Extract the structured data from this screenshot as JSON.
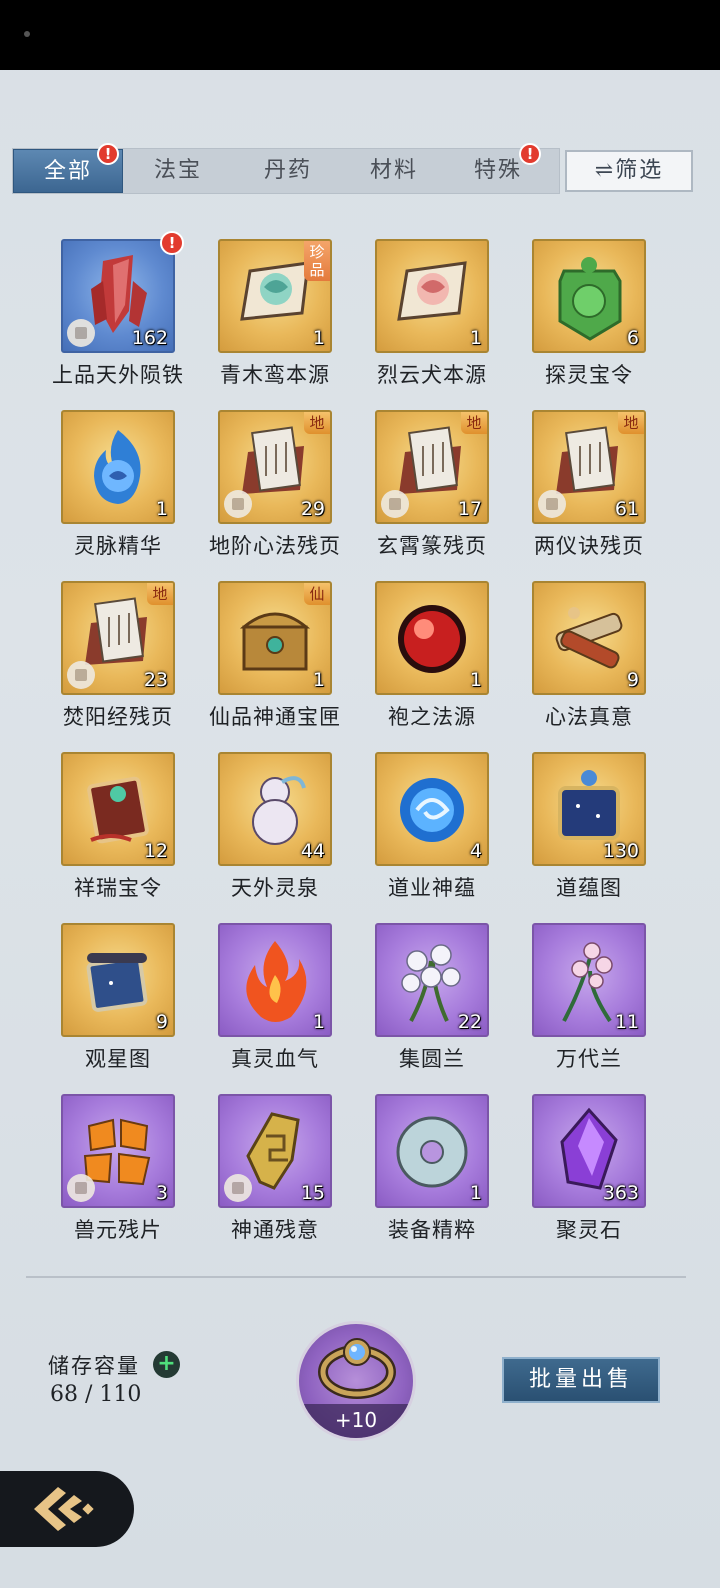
{
  "tabs": [
    {
      "label": "全部",
      "active": true,
      "badge": "!"
    },
    {
      "label": "法宝",
      "active": false
    },
    {
      "label": "丹药",
      "active": false
    },
    {
      "label": "材料",
      "active": false
    },
    {
      "label": "特殊",
      "active": false,
      "badge": "!"
    }
  ],
  "filter_label": "⇌筛选",
  "items": [
    {
      "name": "上品天外陨铁",
      "count": "162",
      "rarity": "blue",
      "icon": "red-crystal-icon",
      "badge": "!"
    },
    {
      "name": "青木鸾本源",
      "count": "1",
      "rarity": "gold",
      "icon": "jade-beast-card-icon",
      "tag": "珍品"
    },
    {
      "name": "烈云犬本源",
      "count": "1",
      "rarity": "gold",
      "icon": "beast-card-icon"
    },
    {
      "name": "探灵宝令",
      "count": "6",
      "rarity": "gold",
      "icon": "green-token-icon"
    },
    {
      "name": "灵脉精华",
      "count": "1",
      "rarity": "gold",
      "icon": "blue-flame-orb-icon"
    },
    {
      "name": "地阶心法残页",
      "count": "29",
      "rarity": "gold",
      "icon": "scripture-page-icon",
      "tag": "地"
    },
    {
      "name": "玄霄篆残页",
      "count": "17",
      "rarity": "gold",
      "icon": "scripture-page-icon",
      "tag": "地"
    },
    {
      "name": "两仪诀残页",
      "count": "61",
      "rarity": "gold",
      "icon": "scripture-page-icon",
      "tag": "地"
    },
    {
      "name": "焚阳经残页",
      "count": "23",
      "rarity": "gold",
      "icon": "scripture-page-icon",
      "tag": "地"
    },
    {
      "name": "仙品神通宝匣",
      "count": "1",
      "rarity": "gold",
      "icon": "treasure-chest-icon",
      "tag": "仙"
    },
    {
      "name": "袍之法源",
      "count": "1",
      "rarity": "gold",
      "icon": "red-orb-icon"
    },
    {
      "name": "心法真意",
      "count": "9",
      "rarity": "gold",
      "icon": "scroll-bundle-icon"
    },
    {
      "name": "祥瑞宝令",
      "count": "12",
      "rarity": "gold",
      "icon": "ornate-token-icon"
    },
    {
      "name": "天外灵泉",
      "count": "44",
      "rarity": "gold",
      "icon": "gourd-icon"
    },
    {
      "name": "道业神蕴",
      "count": "4",
      "rarity": "gold",
      "icon": "blue-vortex-icon"
    },
    {
      "name": "道蕴图",
      "count": "130",
      "rarity": "gold",
      "icon": "starry-scroll-icon"
    },
    {
      "name": "观星图",
      "count": "9",
      "rarity": "gold",
      "icon": "star-map-scroll-icon"
    },
    {
      "name": "真灵血气",
      "count": "1",
      "rarity": "purple",
      "icon": "fire-spirit-icon"
    },
    {
      "name": "集圆兰",
      "count": "22",
      "rarity": "purple",
      "icon": "white-orchid-icon"
    },
    {
      "name": "万代兰",
      "count": "11",
      "rarity": "purple",
      "icon": "pink-orchid-icon"
    },
    {
      "name": "兽元残片",
      "count": "3",
      "rarity": "purple",
      "icon": "orange-shards-icon"
    },
    {
      "name": "神通残意",
      "count": "15",
      "rarity": "purple",
      "icon": "golden-fragment-icon"
    },
    {
      "name": "装备精粹",
      "count": "1",
      "rarity": "purple",
      "icon": "jade-disc-icon"
    },
    {
      "name": "聚灵石",
      "count": "363",
      "rarity": "purple",
      "icon": "purple-crystal-icon"
    }
  ],
  "storage": {
    "label": "储存容量",
    "plus": "+",
    "value": "68 / 110"
  },
  "equipment": {
    "level": "+10",
    "icon": "ring-icon"
  },
  "bulk_sell_label": "批量出售",
  "colors": {
    "active_tab": "#4a76a1",
    "badge": "#e23b2e",
    "gold": "#e9b85a",
    "purple": "#a77cdc",
    "blue": "#5f8ad0"
  }
}
